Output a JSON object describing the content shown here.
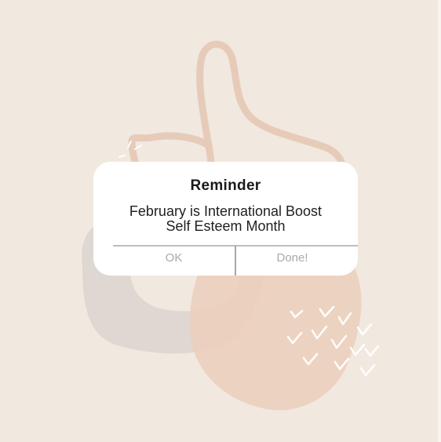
{
  "dialog": {
    "title": "Reminder",
    "message_line1": "February is International Boost",
    "message_line2": "Self Esteem Month",
    "buttons": {
      "ok": "OK",
      "done": "Done!"
    }
  },
  "colors": {
    "background": "#f1e8e0",
    "peach_shape": "#ebcfbd",
    "gray_shape": "#ddd6d1",
    "dialog_bg": "#ffffff",
    "button_text": "#a9a9a9"
  }
}
